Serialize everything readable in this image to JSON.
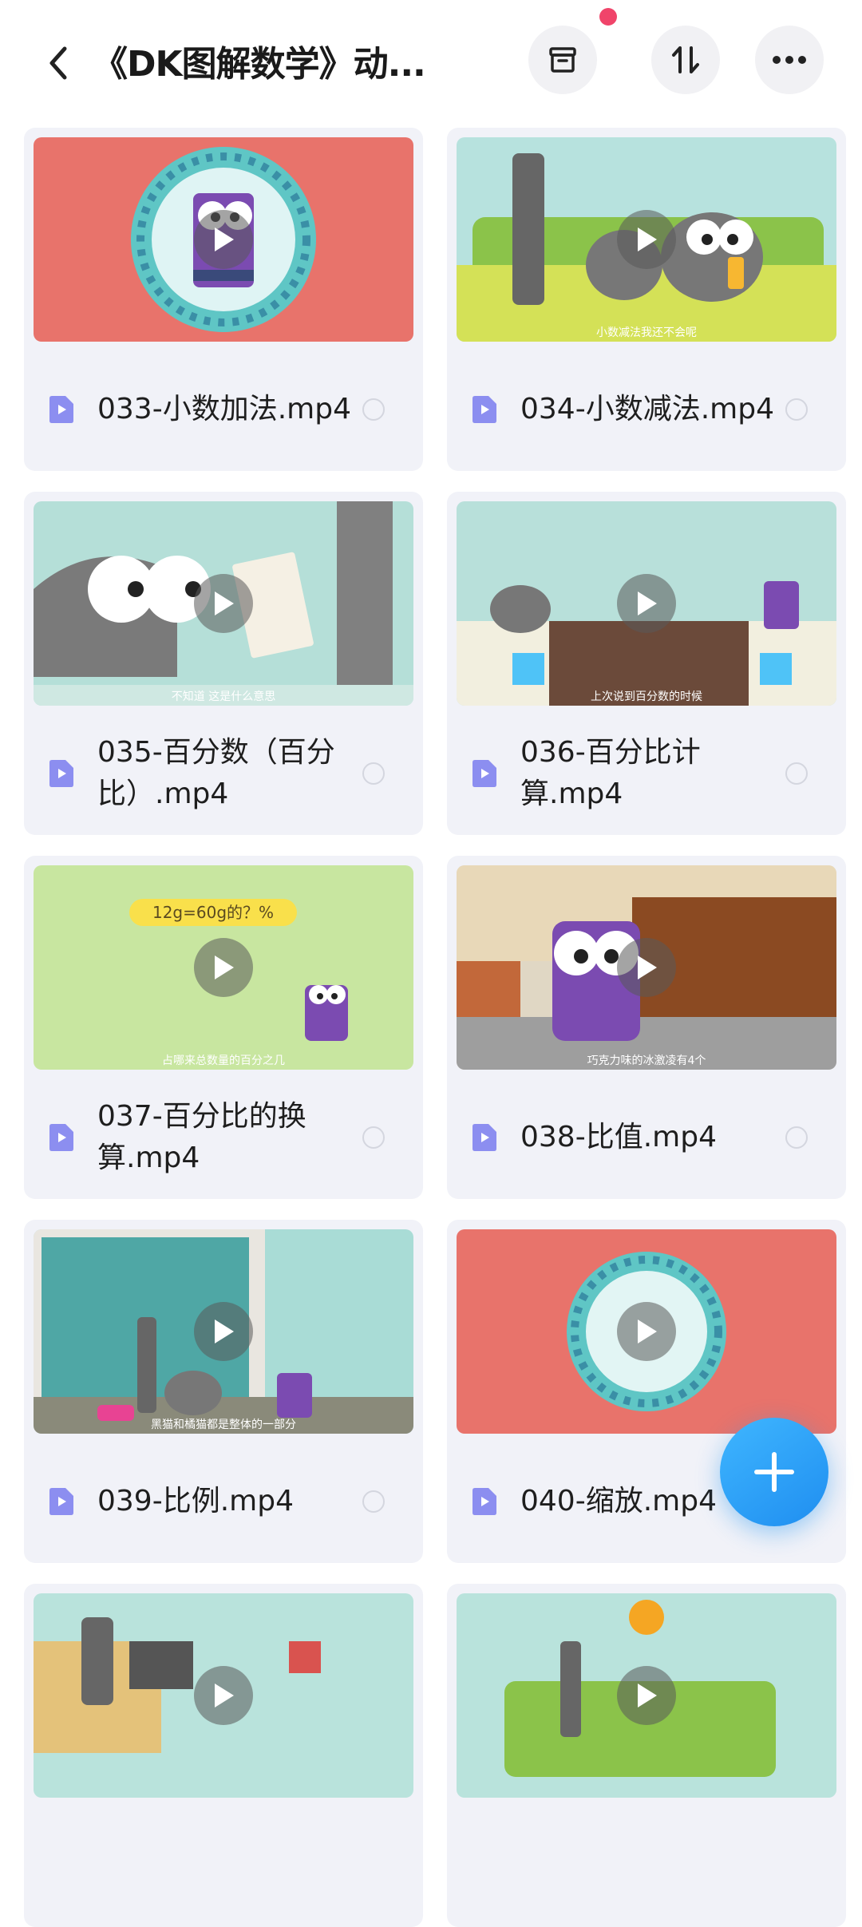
{
  "header": {
    "title": "《DK图解数学》动...",
    "back_icon": "chevron-left-icon",
    "buttons": [
      {
        "name": "archive-button",
        "icon": "archive-icon"
      },
      {
        "name": "sort-button",
        "icon": "sort-icon"
      },
      {
        "name": "more-button",
        "icon": "more-horizontal-icon"
      }
    ],
    "notification_color": "#f0446a"
  },
  "files": [
    {
      "name": "033-小数加法.mp4",
      "thumb_caption": ""
    },
    {
      "name": "034-小数减法.mp4",
      "thumb_caption": "小数减法我还不会呢"
    },
    {
      "name": "035-百分数（百分比）.mp4",
      "thumb_caption": "不知道 这是什么意思"
    },
    {
      "name": "036-百分比计算.mp4",
      "thumb_caption": "上次说到百分数的时候"
    },
    {
      "name": "037-百分比的换算.mp4",
      "thumb_caption": "占哪来总数量的百分之几",
      "thumb_banner": "12g=60g的？%"
    },
    {
      "name": "038-比值.mp4",
      "thumb_caption": "巧克力味的冰激凌有4个"
    },
    {
      "name": "039-比例.mp4",
      "thumb_caption": "黑猫和橘猫都是整体的一部分"
    },
    {
      "name": "040-缩放.mp4",
      "thumb_caption": ""
    },
    {
      "name": "",
      "thumb_caption": ""
    },
    {
      "name": "",
      "thumb_caption": ""
    }
  ],
  "fab": {
    "icon": "plus-icon",
    "color": "#2a9cf5"
  }
}
